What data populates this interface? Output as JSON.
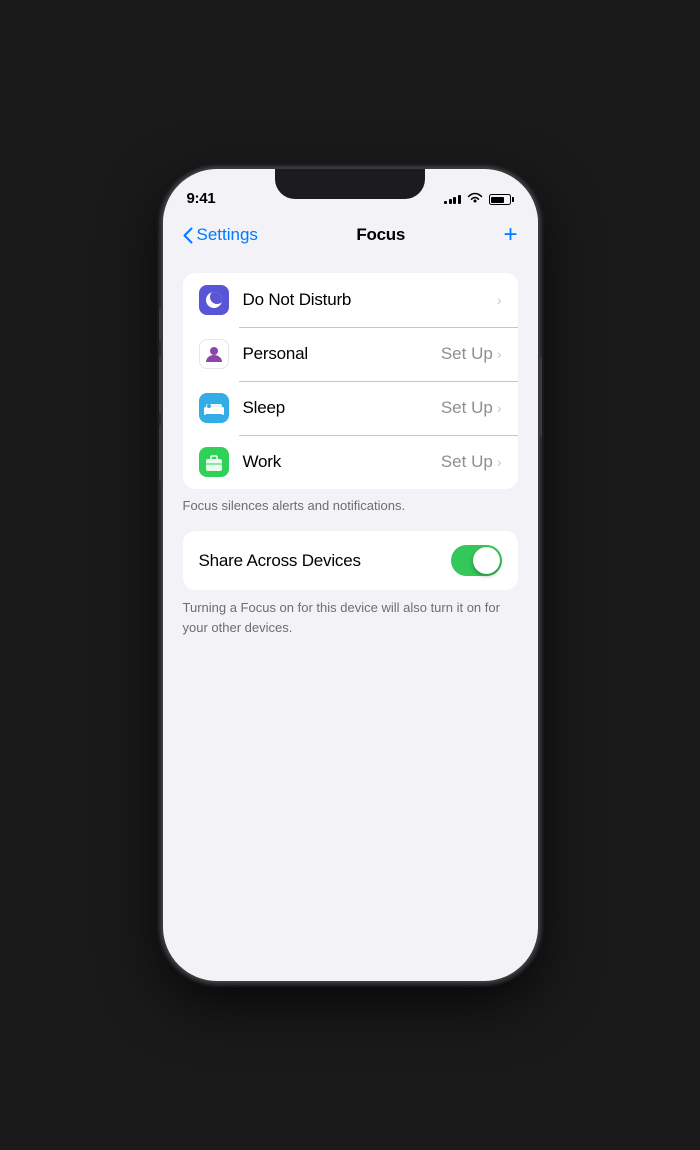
{
  "status_bar": {
    "time": "9:41",
    "signal_bars": [
      3,
      5,
      7,
      9,
      11
    ],
    "battery_percent": 75
  },
  "nav": {
    "back_label": "Settings",
    "title": "Focus",
    "add_button_label": "+"
  },
  "focus_items": [
    {
      "id": "do-not-disturb",
      "label": "Do Not Disturb",
      "setup": "",
      "icon_type": "dnd"
    },
    {
      "id": "personal",
      "label": "Personal",
      "setup": "Set Up",
      "icon_type": "personal"
    },
    {
      "id": "sleep",
      "label": "Sleep",
      "setup": "Set Up",
      "icon_type": "sleep"
    },
    {
      "id": "work",
      "label": "Work",
      "setup": "Set Up",
      "icon_type": "work"
    }
  ],
  "focus_caption": "Focus silences alerts and notifications.",
  "share_across_devices": {
    "label": "Share Across Devices",
    "toggle_on": true
  },
  "share_caption": "Turning a Focus on for this device will also turn it on for your other devices.",
  "colors": {
    "blue": "#007aff",
    "green": "#34c759",
    "purple": "#5856d6",
    "teal": "#32ade6",
    "mint": "#30d158"
  }
}
